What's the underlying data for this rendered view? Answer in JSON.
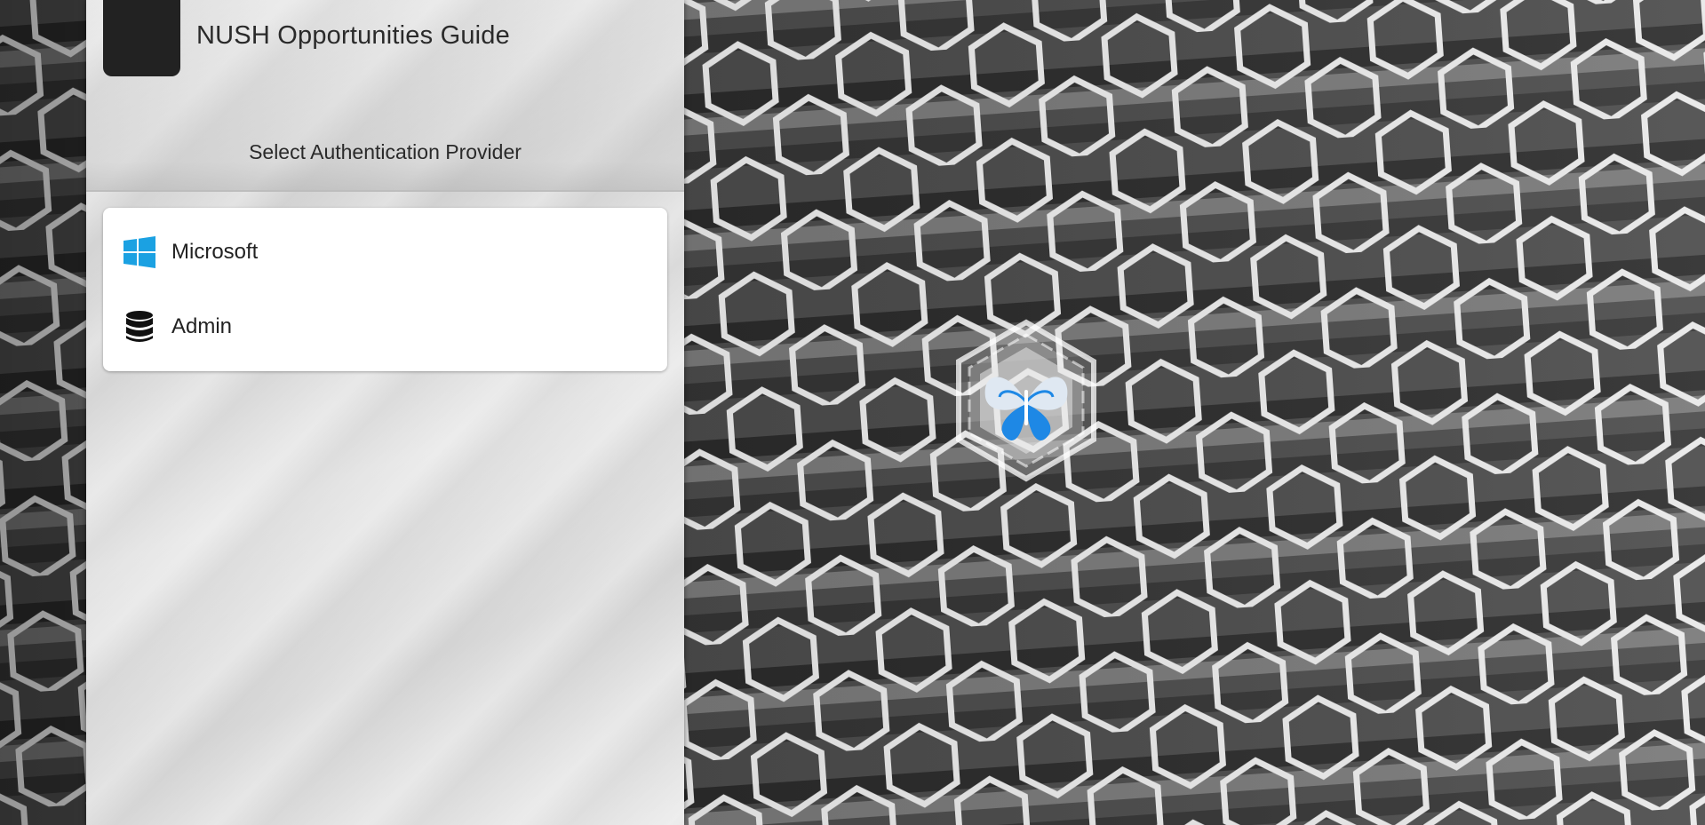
{
  "app": {
    "title": "NUSH Opportunities Guide",
    "subtitle": "Select Authentication Provider"
  },
  "providers": [
    {
      "label": "Microsoft",
      "icon": "windows-logo-icon",
      "color": "#1ba1e2"
    },
    {
      "label": "Admin",
      "icon": "database-icon",
      "color": "#111111"
    }
  ],
  "theme": {
    "panel_bg": "#e0e0e0",
    "logo_box": "#222222",
    "badge_accent": "#1e88e5"
  }
}
